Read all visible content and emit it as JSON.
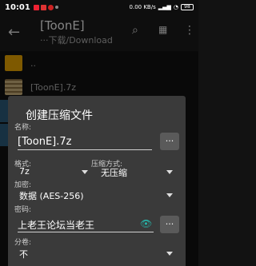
{
  "status": {
    "time": "10:01",
    "net": "0.00 KB/s",
    "battery": "98"
  },
  "appbar": {
    "title": "[ToonE]",
    "path": "···下载/Download"
  },
  "files": [
    {
      "name": ".."
    },
    {
      "name": "[ToonE].7z"
    }
  ],
  "dialog": {
    "title": "创建压缩文件",
    "name_label": "名称:",
    "name_value": "[ToonE].7z",
    "browse_label": "...",
    "format_label": "格式:",
    "format_value": "7z",
    "compression_label": "压缩方式:",
    "compression_value": "无压缩",
    "encryption_label": "加密:",
    "encryption_value": "数据 (AES-256)",
    "password_label": "密码:",
    "password_value": "上老王论坛当老王",
    "password_more": "...",
    "split_label": "分卷:",
    "split_value": "不"
  }
}
